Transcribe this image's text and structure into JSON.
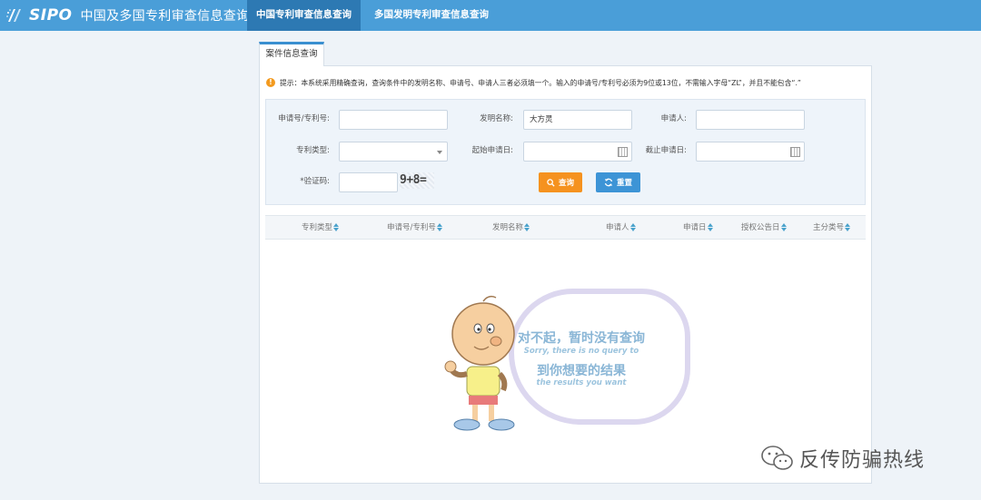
{
  "header": {
    "brand": "SIPO",
    "site_title": "中国及多国专利审查信息查询",
    "tabs": [
      {
        "label": "中国专利审查信息查询",
        "active": true
      },
      {
        "label": "多国发明专利审查信息查询",
        "active": false
      }
    ]
  },
  "panel": {
    "tab_label": "案件信息查询",
    "notice": "提示：本系统采用精确查询，查询条件中的发明名称、申请号、申请人三者必须填一个。输入的申请号/专利号必须为9位或13位，不需输入字母“ZL”，并且不能包含“.”"
  },
  "form": {
    "app_no_label": "申请号/专利号:",
    "app_no_value": "",
    "invention_name_label": "发明名称:",
    "invention_name_value": "大方灵",
    "applicant_label": "申请人:",
    "applicant_value": "",
    "patent_type_label": "专利类型:",
    "patent_type_value": "",
    "start_date_label": "起始申请日:",
    "start_date_value": "",
    "end_date_label": "截止申请日:",
    "end_date_value": "",
    "captcha_label": "*验证码:",
    "captcha_value": "",
    "captcha_image": "9+8=",
    "search_button": "查询",
    "reset_button": "重置"
  },
  "table": {
    "columns": [
      "专利类型",
      "申请号/专利号",
      "发明名称",
      "申请人",
      "申请日",
      "授权公告日",
      "主分类号"
    ]
  },
  "empty_state": {
    "title": "对不起，暂时没有查询",
    "subtitle_en": "Sorry, there is no query to",
    "title2": "到你想要的结果",
    "subtitle_en2": "the results you want"
  },
  "watermark": {
    "text": "反传防骗热线"
  },
  "colors": {
    "header_bg": "#4a9ed8",
    "active_tab": "#2d79b3",
    "search_button": "#f5921f",
    "reset_button": "#3d94d6",
    "notice_icon": "#f39a1e"
  }
}
